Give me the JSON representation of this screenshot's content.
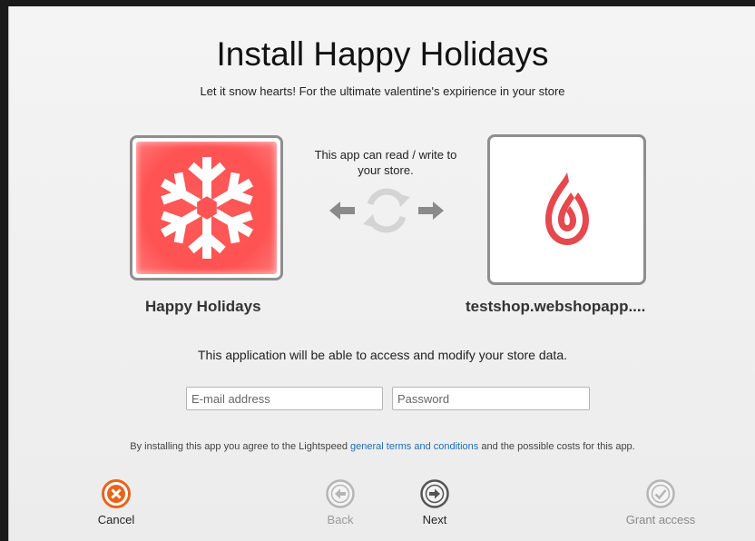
{
  "dialog": {
    "title": "Install Happy Holidays",
    "subtitle": "Let it snow hearts! For the ultimate valentine's expirience in your store"
  },
  "app": {
    "name": "Happy Holidays",
    "icon": "snowflake-icon",
    "tile_color": "#ff5252"
  },
  "store": {
    "name": "testshop.webshopapp....",
    "icon": "lightspeed-flame-icon",
    "logo_color": "#e5484d"
  },
  "permission": {
    "text": "This app can read / write to your store."
  },
  "access_text": "This application will be able to access and modify your store data.",
  "form": {
    "email_placeholder": "E-mail address",
    "password_placeholder": "Password"
  },
  "terms": {
    "prefix": "By installing this app you agree to the Lightspeed ",
    "link": "general terms and conditions",
    "suffix": " and the possible costs for this app."
  },
  "actions": {
    "cancel": "Cancel",
    "back": "Back",
    "next": "Next",
    "grant": "Grant access"
  },
  "colors": {
    "cancel": "#e8641b",
    "link": "#1f6fb3",
    "disabled": "#aaaaaa"
  }
}
